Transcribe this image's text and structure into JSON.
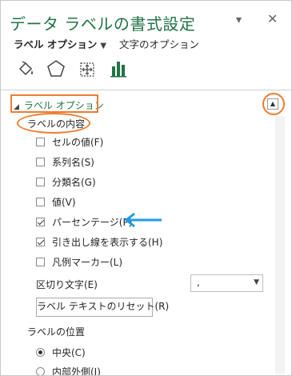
{
  "pane": {
    "title": "データ ラベルの書式設定",
    "pin_icon": "pin-dropdown-icon",
    "close_icon": "close-icon"
  },
  "tabs": {
    "active_label": "ラベル オプション",
    "other_label": "文字のオプション"
  },
  "category_icons": [
    "fill-line-icon",
    "effects-pentagon-icon",
    "size-properties-icon",
    "label-options-chart-icon"
  ],
  "section": {
    "title": "ラベル オプション",
    "subhead": "ラベルの内容"
  },
  "options": [
    {
      "label": "セルの値(F)",
      "checked": false
    },
    {
      "label": "系列名(S)",
      "checked": false
    },
    {
      "label": "分類名(G)",
      "checked": false
    },
    {
      "label": "値(V)",
      "checked": false
    },
    {
      "label": "パーセンテージ(P)",
      "checked": true
    },
    {
      "label": "引き出し線を表示する(H)",
      "checked": true
    },
    {
      "label": "凡例マーカー(L)",
      "checked": false
    }
  ],
  "separator": {
    "label": "区切り文字(E)",
    "value": ","
  },
  "reset_button": "ラベル テキストのリセット(R)",
  "position": {
    "label": "ラベルの位置",
    "options": [
      {
        "label": "中央(C)",
        "selected": true
      },
      {
        "label": "内部外側(I)",
        "selected": false
      }
    ]
  },
  "colors": {
    "accent": "#217346",
    "highlight": "#ed7d31",
    "arrow": "#1e9be9"
  }
}
